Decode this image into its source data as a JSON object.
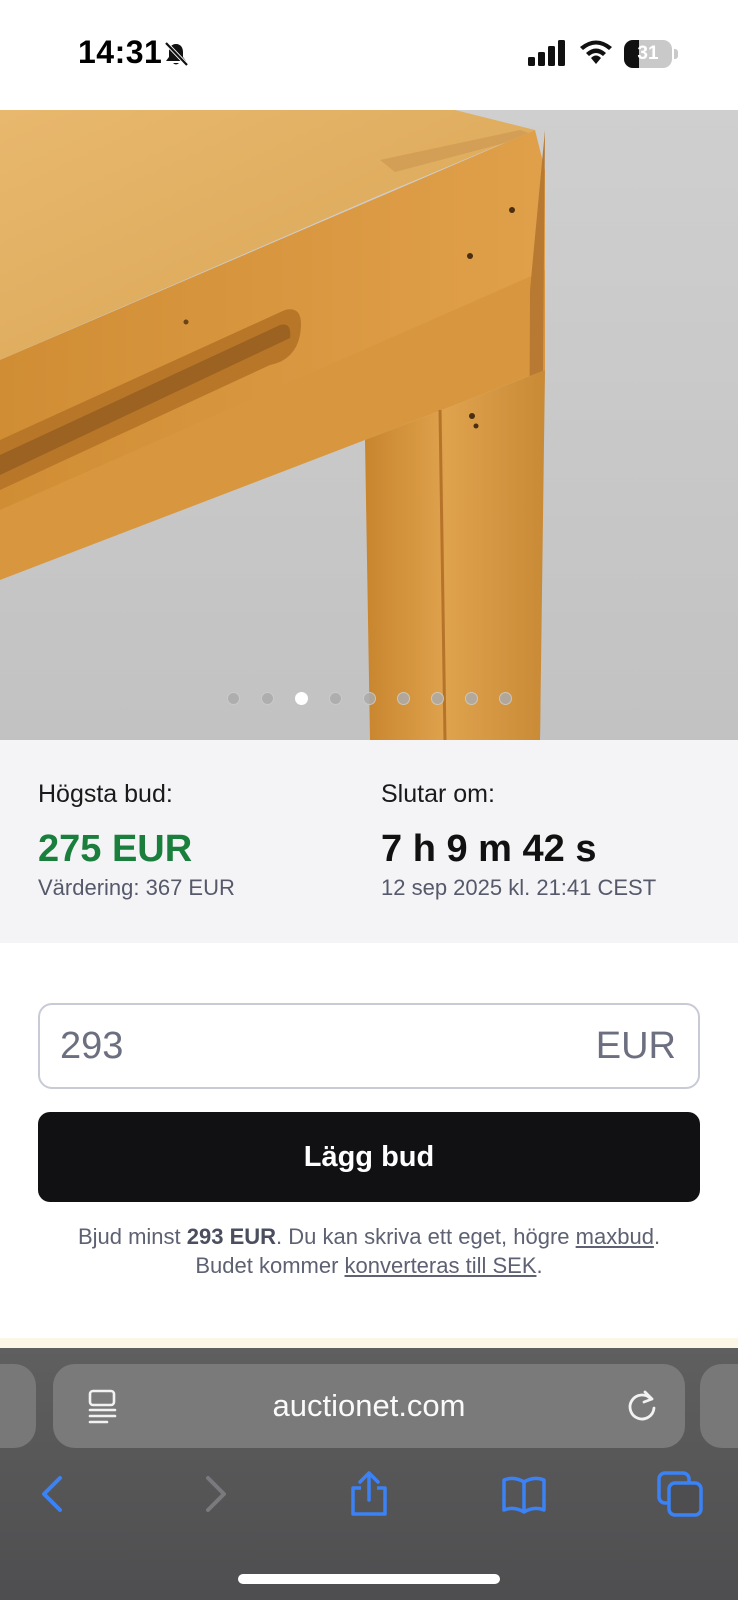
{
  "status_bar": {
    "time": "14:31",
    "battery_level": "31",
    "battery_fraction": 0.31
  },
  "gallery": {
    "image_count": 9,
    "active_index": 2
  },
  "bid_info": {
    "highest_label": "Högsta bud:",
    "highest_value": "275 EUR",
    "valuation": "Värdering: 367 EUR",
    "ends_label": "Slutar om:",
    "countdown": "7 h 9 m 42 s",
    "end_time": "12 sep 2025 kl. 21:41 CEST"
  },
  "bid_form": {
    "input_value": "293",
    "currency": "EUR",
    "submit_label": "Lägg bud",
    "help_prefix": "Bjud minst ",
    "help_min": "293 EUR",
    "help_middle": ". Du kan skriva ett eget, högre ",
    "help_link_maxbid": "maxbud",
    "help_end1": ".",
    "help_line2_prefix": "Budet kommer ",
    "help_link_convert": "konverteras till SEK",
    "help_end2": "."
  },
  "browser": {
    "url": "auctionet.com"
  },
  "colors": {
    "accent_green": "#1a7f3c",
    "button_dark": "#111114",
    "browser_blue": "#3b82f6"
  },
  "icons": [
    "bell-slash-icon",
    "signal-icon",
    "wifi-icon",
    "battery-icon",
    "reader-icon",
    "reload-icon",
    "back-icon",
    "forward-icon",
    "share-icon",
    "bookmarks-icon",
    "tabs-icon"
  ]
}
